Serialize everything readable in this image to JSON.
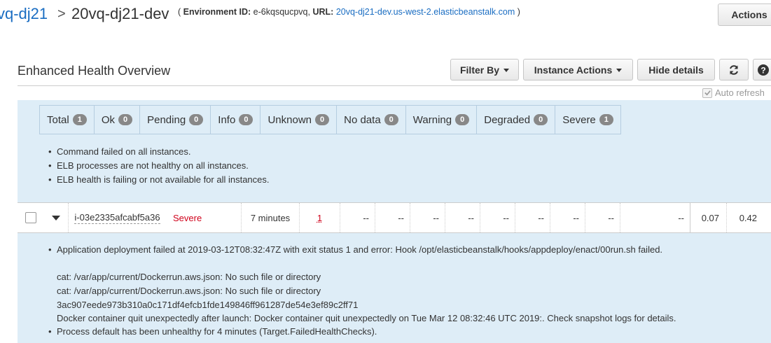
{
  "breadcrumb": {
    "parent": "vq-dj21",
    "separator": ">",
    "current": "20vq-dj21-dev",
    "env_prefix": "( ",
    "env_id_label": "Environment ID:",
    "env_id": "e-6kqsqucpvq,",
    "url_label": "URL:",
    "url": "20vq-dj21-dev.us-west-2.elasticbeanstalk.com",
    "env_suffix": " )"
  },
  "actions_button": "Actions",
  "section_title": "Enhanced Health Overview",
  "toolbar": {
    "filter_by": "Filter By",
    "instance_actions": "Instance Actions",
    "hide_details": "Hide details",
    "refresh_icon": "refresh-icon",
    "help_icon": "help-icon"
  },
  "auto_refresh": {
    "label": "Auto refresh",
    "checked": true
  },
  "status_tabs": [
    {
      "label": "Total",
      "count": "1"
    },
    {
      "label": "Ok",
      "count": "0"
    },
    {
      "label": "Pending",
      "count": "0"
    },
    {
      "label": "Info",
      "count": "0"
    },
    {
      "label": "Unknown",
      "count": "0"
    },
    {
      "label": "No data",
      "count": "0"
    },
    {
      "label": "Warning",
      "count": "0"
    },
    {
      "label": "Degraded",
      "count": "0"
    },
    {
      "label": "Severe",
      "count": "1"
    }
  ],
  "environment_causes": [
    "Command failed on all instances.",
    "ELB processes are not healthy on all instances.",
    "ELB health is failing or not available for all instances."
  ],
  "instance_row": {
    "id": "i-03e2335afcabf5a36",
    "status": "Severe",
    "running_for": "7 minutes",
    "deployment": "1",
    "dashes": [
      "--",
      "--",
      "--",
      "--",
      "--",
      "--",
      "--",
      "--",
      "--"
    ],
    "load1": "0.07",
    "load5": "0.42"
  },
  "instance_details": {
    "deploy_error": "Application deployment failed at 2019-03-12T08:32:47Z with exit status 1 and error: Hook /opt/elasticbeanstalk/hooks/appdeploy/enact/00run.sh failed.",
    "log_lines": [
      "cat: /var/app/current/Dockerrun.aws.json: No such file or directory",
      "cat: /var/app/current/Dockerrun.aws.json: No such file or directory",
      "3ac907eede973b310a0c171df4efcb1fde149846ff961287de54e3ef89c2ff71",
      "Docker container quit unexpectedly after launch: Docker container quit unexpectedly on Tue Mar 12 08:32:46 UTC 2019:. Check snapshot logs for details."
    ],
    "process_status": "Process default has been unhealthy for 4 minutes (Target.FailedHealthChecks)."
  },
  "colors": {
    "link": "#1a6dc2",
    "severe": "#d0021b",
    "panel": "#deedf7",
    "badge": "#888888"
  }
}
